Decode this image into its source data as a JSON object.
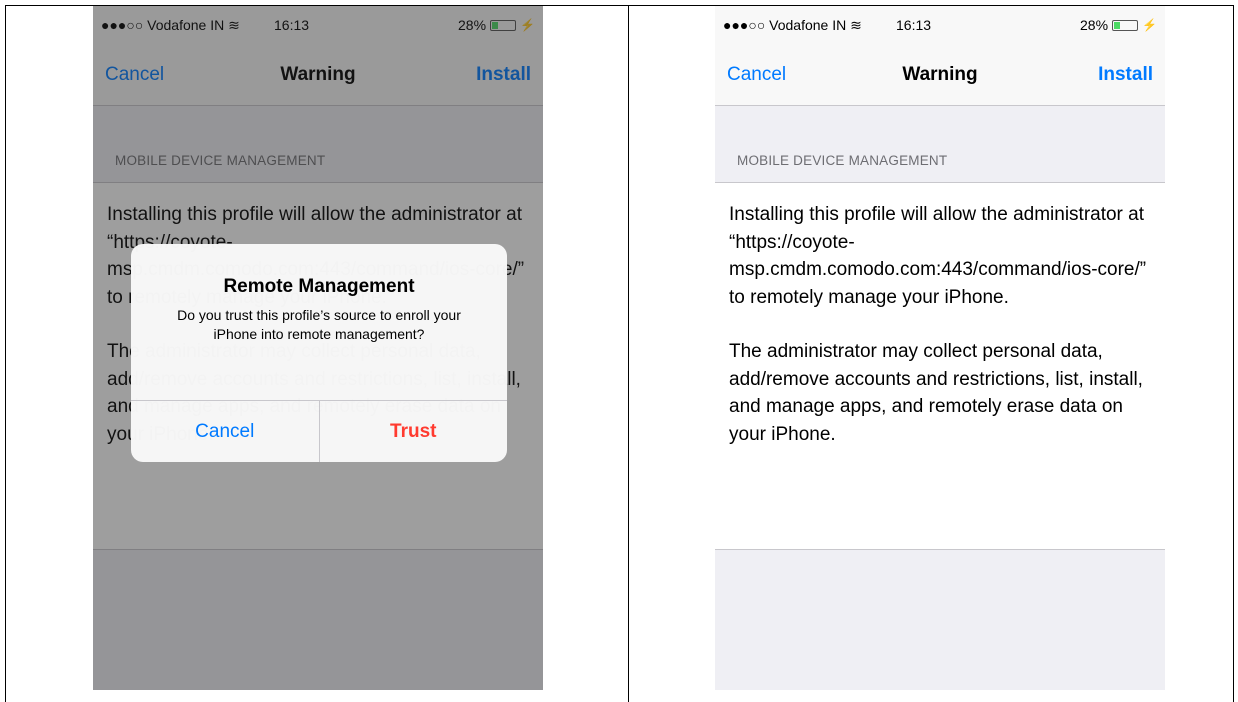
{
  "status_bar": {
    "carrier": "●●●○○ Vodafone IN ",
    "wifi_icon": "wifi-icon",
    "time": "16:13",
    "battery_percent": "28%",
    "battery_level": 0.28,
    "charge_glyph": "⚡"
  },
  "nav": {
    "cancel_label": "Cancel",
    "title": "Warning",
    "install_label": "Install"
  },
  "section_header": "MOBILE DEVICE MANAGEMENT",
  "body": {
    "paragraph1": "Installing this profile will allow the administrator at “https://coyote-msp.cmdm.comodo.com:443/command/ios-core/” to remotely manage your iPhone.",
    "paragraph2": "The administrator may collect personal data, add/remove accounts and restrictions, list, install, and manage apps, and remotely erase data on your iPhone."
  },
  "alert": {
    "title": "Remote Management",
    "message": "Do you trust this profile’s source to enroll your iPhone into remote management?",
    "cancel_label": "Cancel",
    "trust_label": "Trust"
  },
  "colors": {
    "accent": "#007aff",
    "destructive": "#ff3b30",
    "background": "#efeff4"
  }
}
